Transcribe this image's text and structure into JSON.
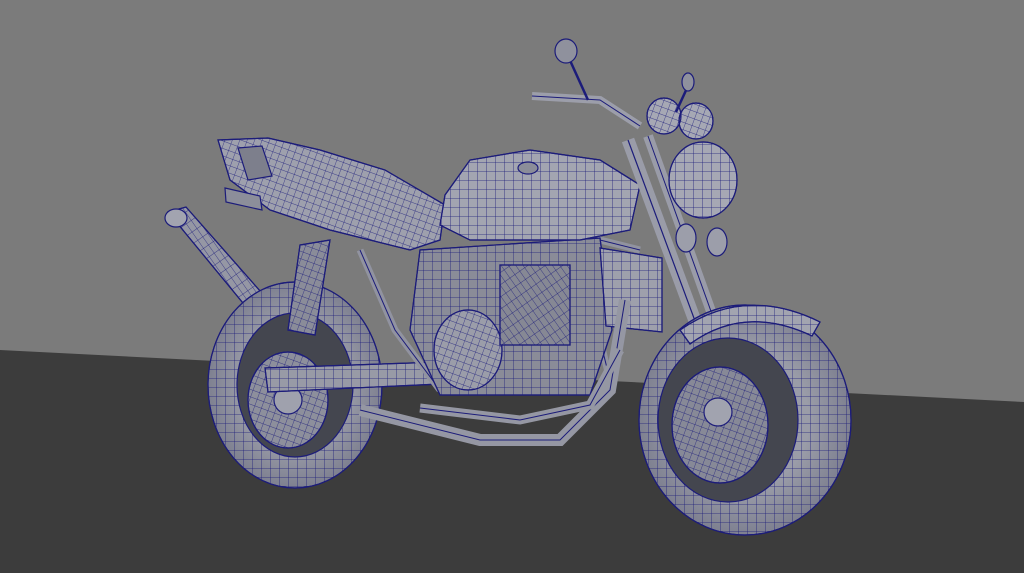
{
  "viewport": {
    "background_color": "#7b7b7b",
    "floor_color": "#3c3c3c",
    "mesh_fill_color": "#8c8e99",
    "mesh_fill_light": "#a4a6b2",
    "wire_color": "#1c1c7a",
    "wire_highlight": "#2e2ec4"
  },
  "model": {
    "display_mode": "wireframe-on-shaded",
    "icon": "motorcycle-model-icon"
  }
}
